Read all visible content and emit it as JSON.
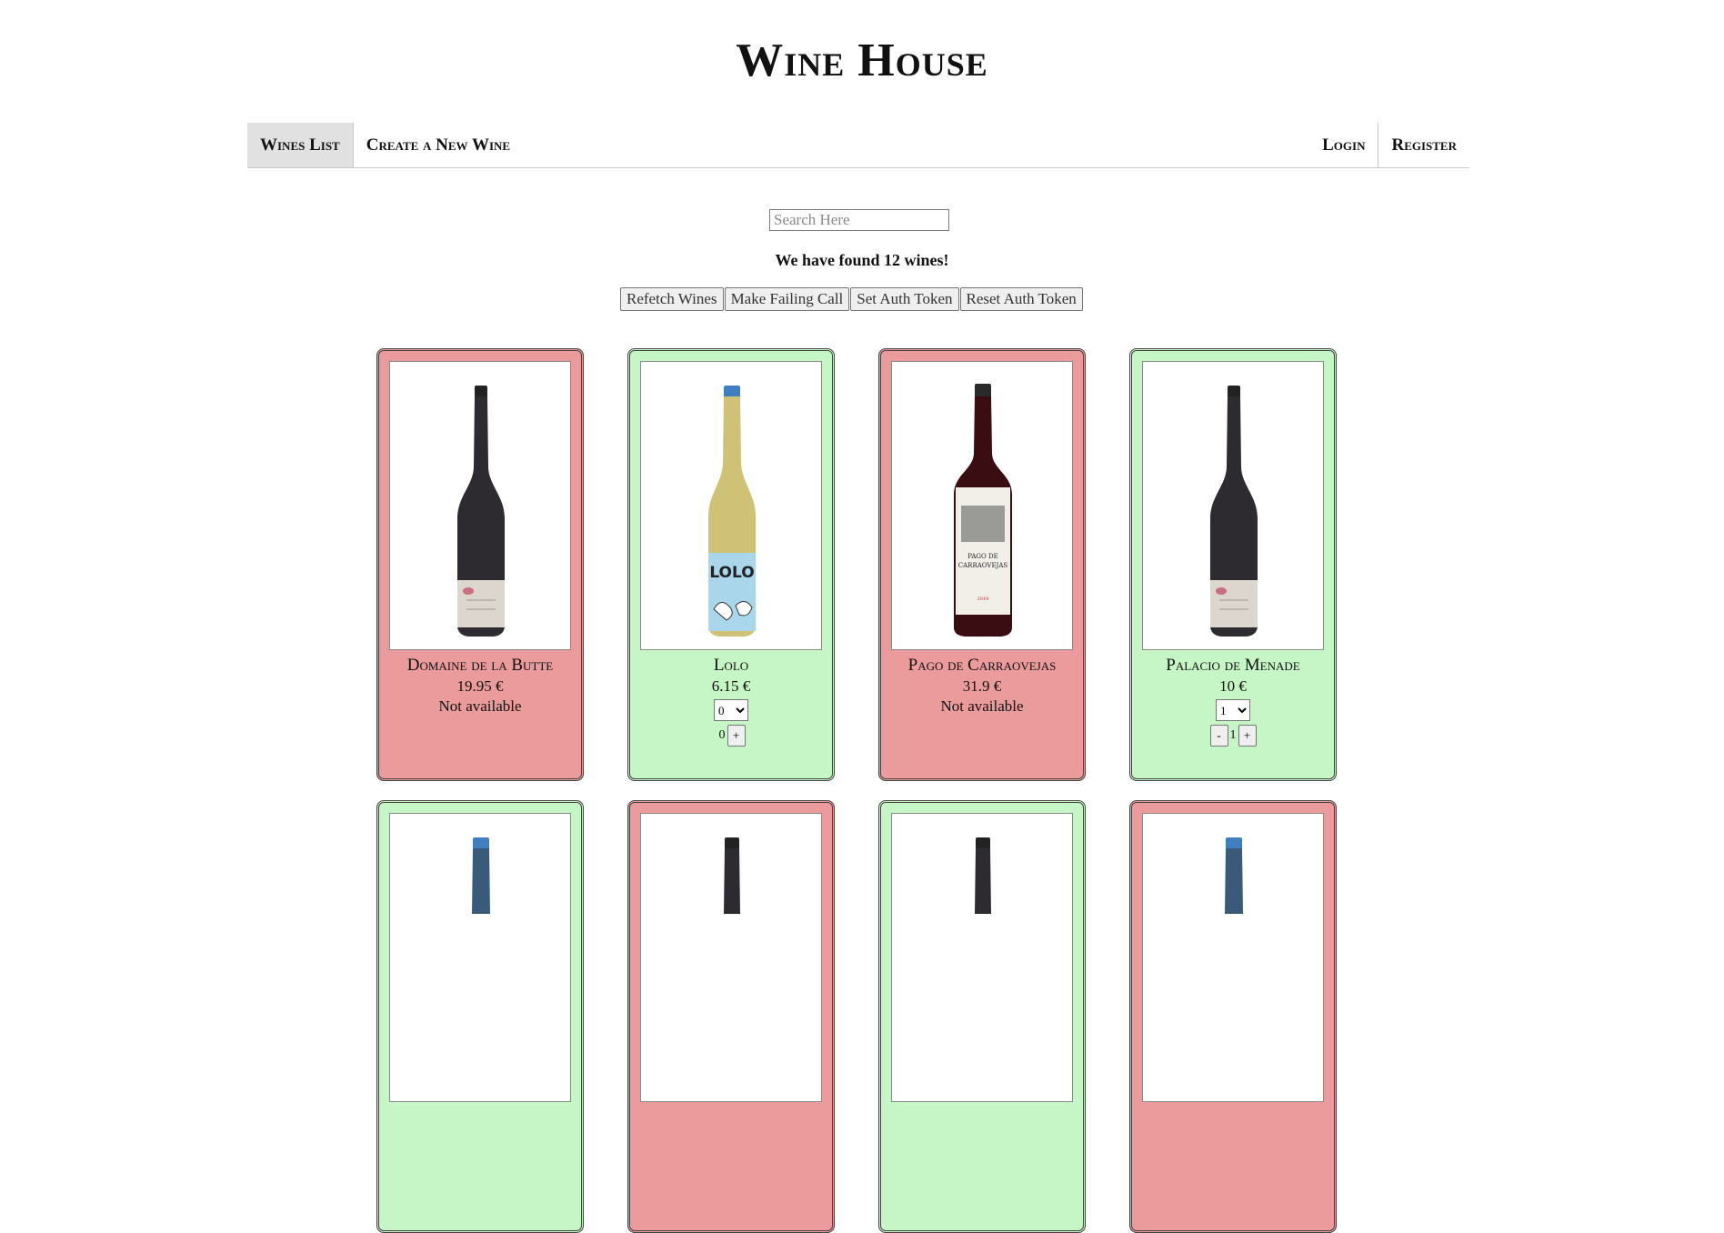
{
  "site": {
    "title": "Wine House"
  },
  "nav": {
    "left": [
      {
        "label": "Wines List",
        "active": true
      },
      {
        "label": "Create a New Wine",
        "active": false
      }
    ],
    "right": [
      {
        "label": "Login"
      },
      {
        "label": "Register"
      }
    ]
  },
  "search": {
    "placeholder": "Search Here",
    "value": ""
  },
  "status": {
    "found_text": "We have found 12 wines!"
  },
  "actions": {
    "refetch": "Refetch Wines",
    "failing": "Make Failing Call",
    "set_token": "Set Auth Token",
    "reset_token": "Reset Auth Token"
  },
  "colors": {
    "available_bg": "#c6f5c6",
    "unavailable_bg": "#eb9b9b",
    "active_nav_bg": "#e1e1e1"
  },
  "wines": [
    {
      "name": "Domaine de la Butte",
      "price": "19.95 €",
      "available": false,
      "status": "Not available",
      "bottle_icon": "red-wine-bottle-icon"
    },
    {
      "name": "Lolo",
      "price": "6.15 €",
      "available": true,
      "qty_selected": "0",
      "cart_count": "0",
      "bottle_icon": "white-wine-bottle-icon"
    },
    {
      "name": "Pago de Carraovejas",
      "price": "31.9 €",
      "available": false,
      "status": "Not available",
      "bottle_icon": "red-wine-bottle-icon"
    },
    {
      "name": "Palacio de Menade",
      "price": "10 €",
      "available": true,
      "qty_selected": "1",
      "cart_count": "1",
      "minus": "-",
      "plus": "+",
      "bottle_icon": "red-wine-bottle-icon"
    }
  ],
  "lolo_plus": "+"
}
